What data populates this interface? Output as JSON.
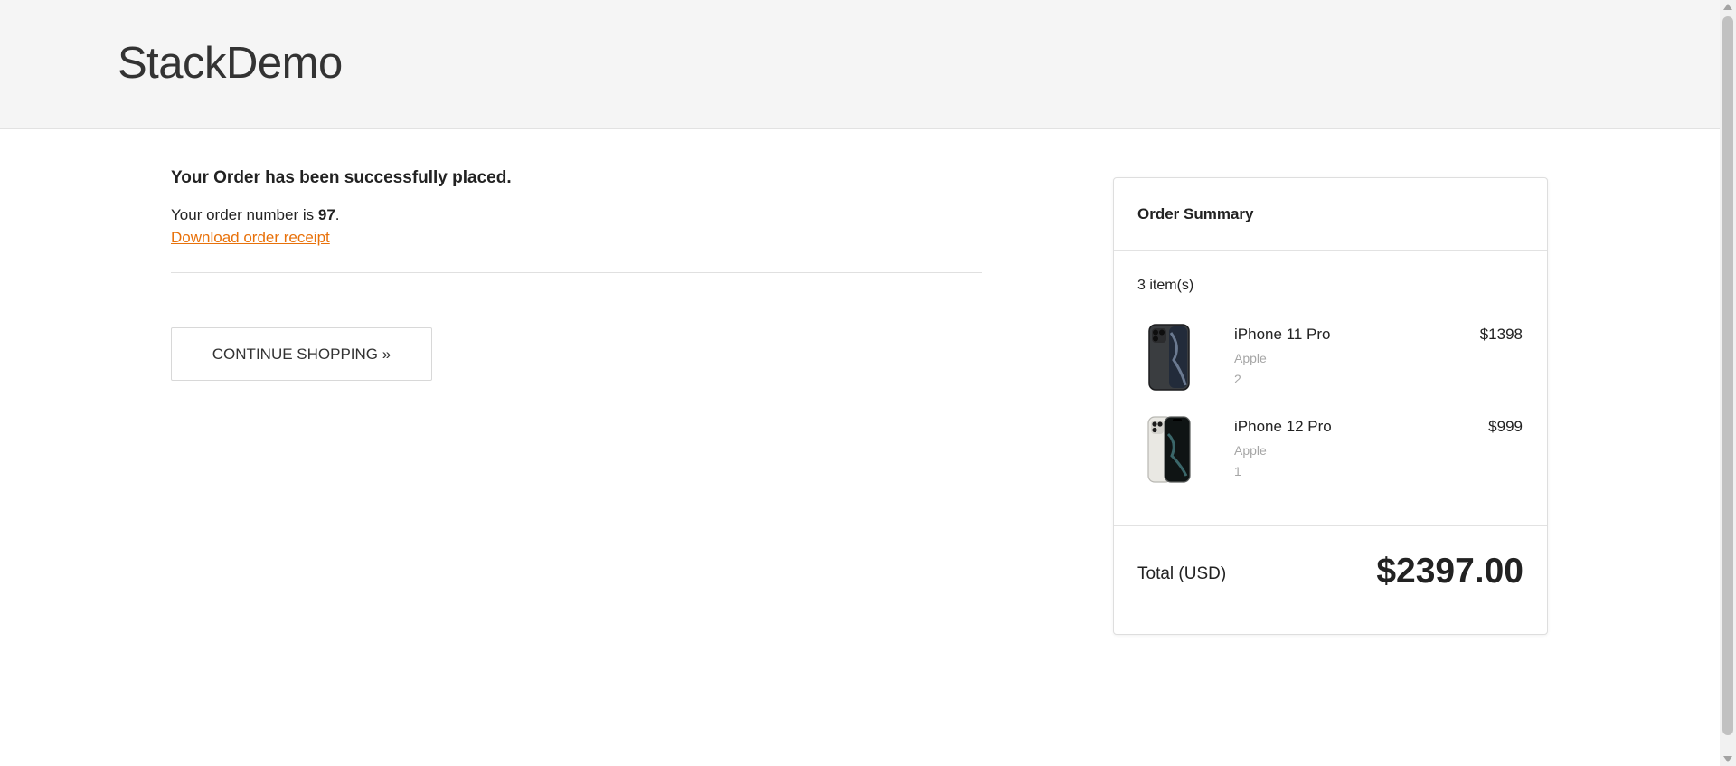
{
  "header": {
    "logo": "StackDemo"
  },
  "confirmation": {
    "title": "Your Order has been successfully placed.",
    "order_prefix": "Your order number is ",
    "order_number": "97",
    "order_suffix": ".",
    "receipt_link": "Download order receipt",
    "continue_button": "CONTINUE SHOPPING »"
  },
  "summary": {
    "title": "Order Summary",
    "item_count": "3 item(s)",
    "items": [
      {
        "name": "iPhone 11 Pro",
        "brand": "Apple",
        "quantity": "2",
        "price": "$1398",
        "icon": "iphone-11-pro-image"
      },
      {
        "name": "iPhone 12 Pro",
        "brand": "Apple",
        "quantity": "1",
        "price": "$999",
        "icon": "iphone-12-pro-image"
      }
    ],
    "total_label": "Total (USD)",
    "total_value": "$2397.00"
  },
  "colors": {
    "link": "#e8710a",
    "header_bg": "#f5f5f5"
  }
}
